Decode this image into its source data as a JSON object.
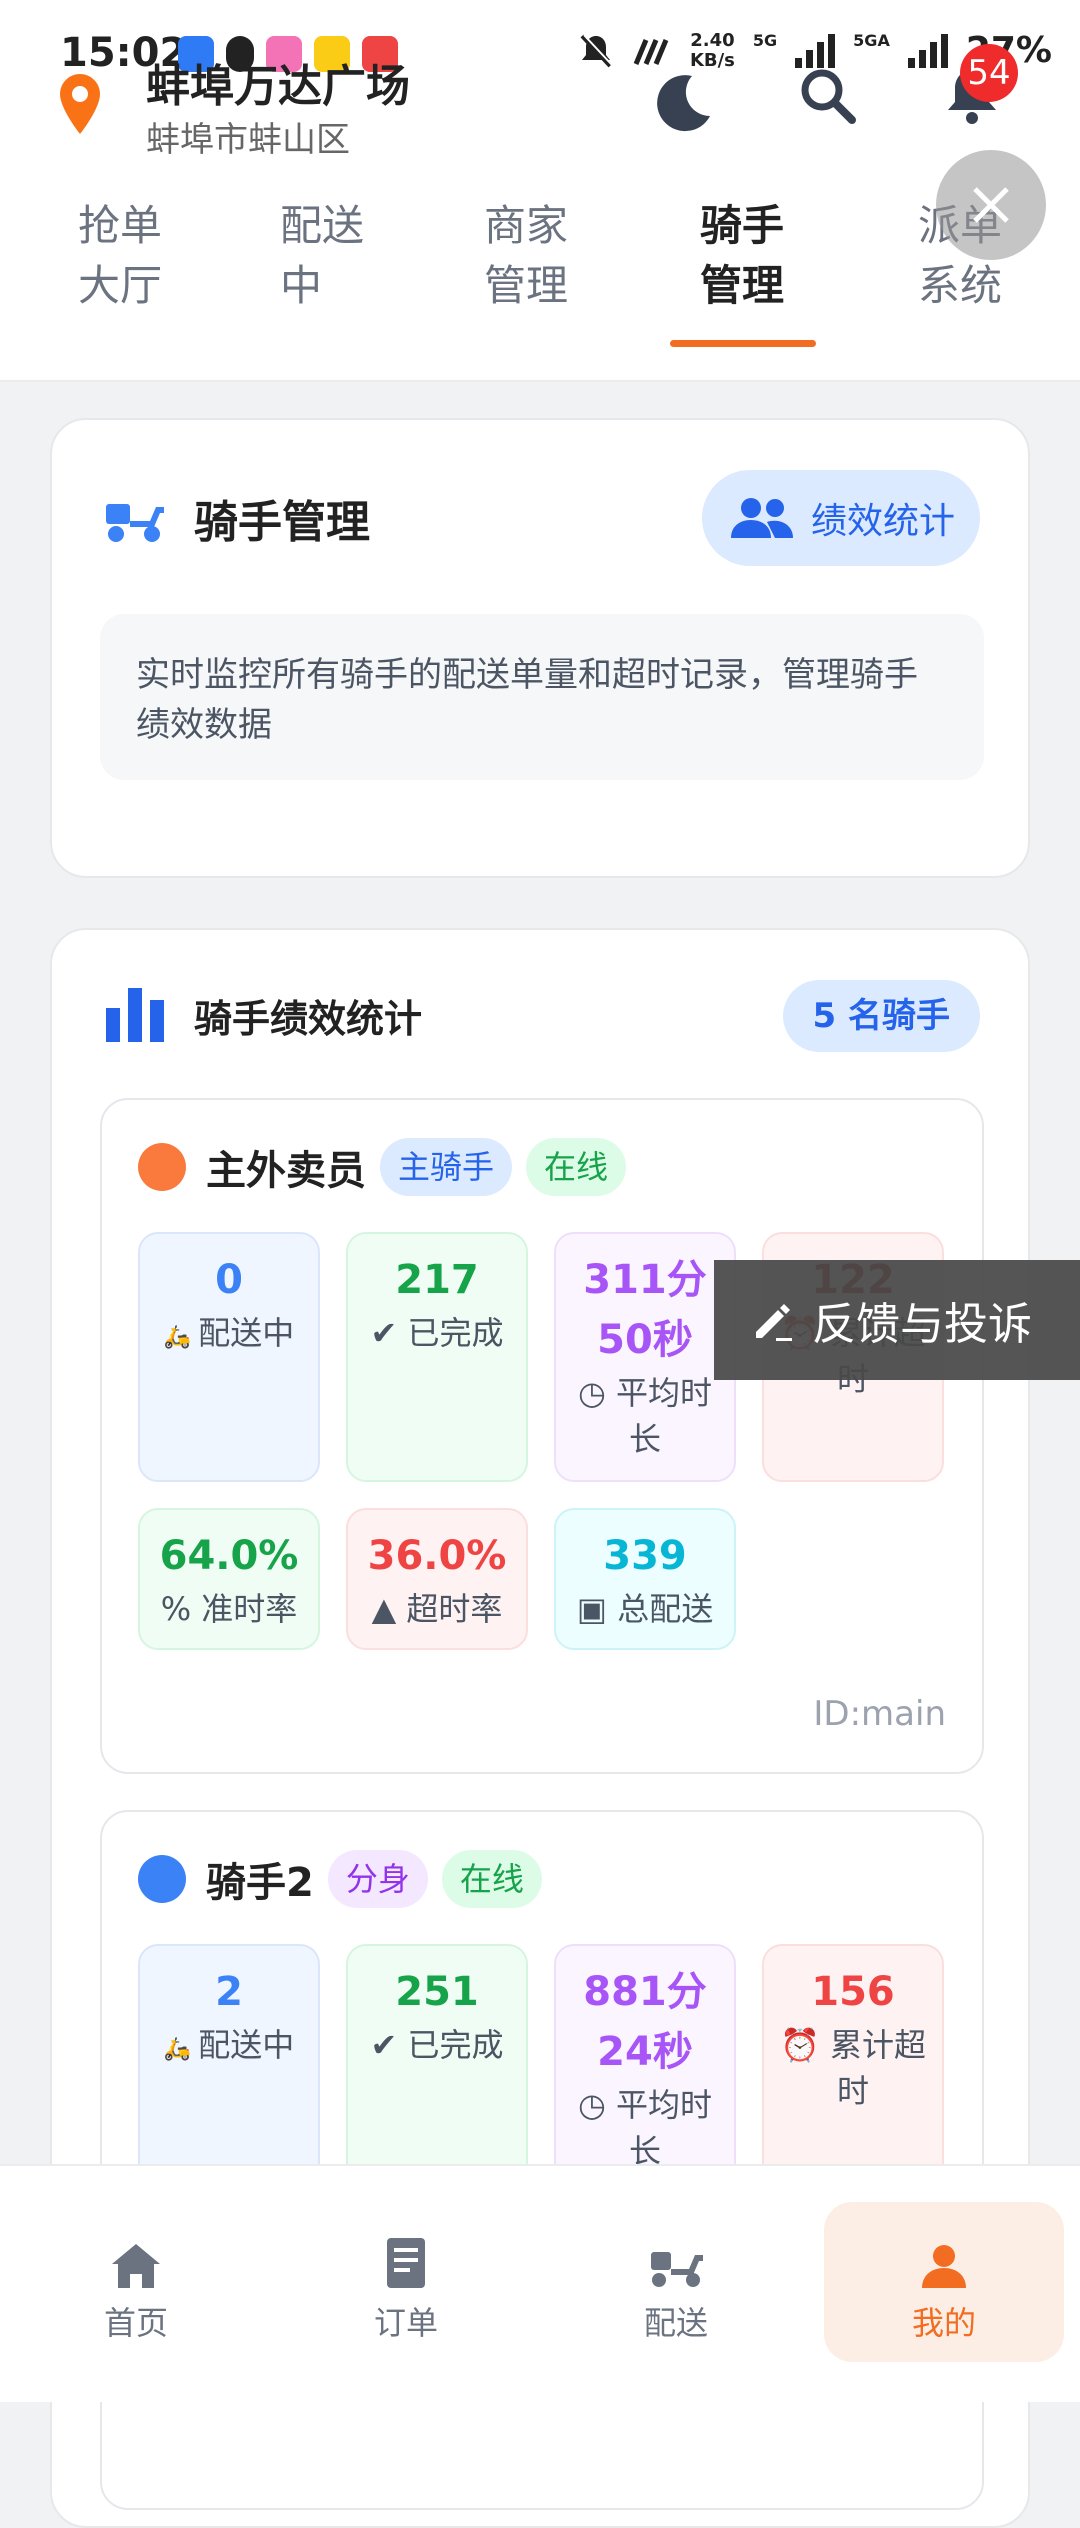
{
  "status_bar": {
    "time": "15:02",
    "speed_top": "2.40",
    "speed_bottom": "KB/s",
    "net1": "5G",
    "net2": "5GA",
    "battery": "27%"
  },
  "header": {
    "location_title": "蚌埠万达广场",
    "location_sub": "蚌埠市蚌山区",
    "notification_count": "54"
  },
  "tabs": [
    {
      "label": "抢单\n大厅"
    },
    {
      "label": "配送\n中"
    },
    {
      "label": "商家\n管理"
    },
    {
      "label": "骑手\n管理"
    },
    {
      "label": "派单\n系统"
    }
  ],
  "management": {
    "title": "骑手管理",
    "perf_button": "绩效统计",
    "description": "实时监控所有骑手的配送单量和超时记录，管理骑手绩效数据"
  },
  "stats_section": {
    "title": "骑手绩效统计",
    "count_label": "5 名骑手",
    "riders": [
      {
        "name": "主外卖员",
        "role": "主骑手",
        "status": "在线",
        "delivering": "0",
        "delivering_label": "配送中",
        "completed": "217",
        "completed_label": "已完成",
        "avg_time": "311分\n50秒",
        "avg_time_label": "平均时\n长",
        "overtime": "122",
        "overtime_label": "累计超\n时",
        "ontime_rate": "64.0%",
        "ontime_label": "准时率",
        "overtime_rate": "36.0%",
        "overtime_rate_label": "超时率",
        "total": "339",
        "total_label": "总配送",
        "id": "ID:main"
      },
      {
        "name": "骑手2",
        "role": "分身",
        "status": "在线",
        "delivering": "2",
        "delivering_label": "配送中",
        "completed": "251",
        "completed_label": "已完成",
        "avg_time": "881分\n24秒",
        "avg_time_label": "平均时\n长",
        "overtime": "156",
        "overtime_label": "累计超\n时"
      }
    ]
  },
  "feedback_label": "反馈与投诉",
  "bottom_nav": [
    {
      "label": "首页"
    },
    {
      "label": "订单"
    },
    {
      "label": "配送"
    },
    {
      "label": "我的"
    }
  ],
  "colors": {
    "accent": "#f26d21",
    "primary_blue": "#2563eb",
    "rider1_dot": "#f97a3c",
    "rider2_dot": "#3b82f6"
  }
}
